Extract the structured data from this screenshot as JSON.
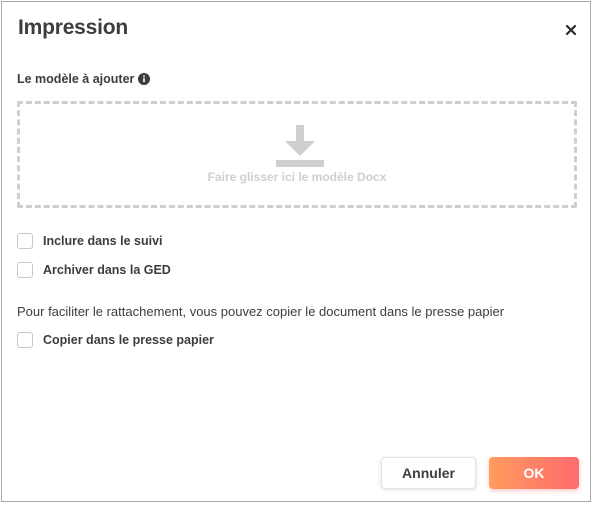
{
  "dialog": {
    "title": "Impression",
    "close_icon": "close-icon"
  },
  "model": {
    "label": "Le modèle à ajouter",
    "info_icon": "info-circle-icon",
    "dropzone_text": "Faire glisser ici le modèle Docx",
    "dropzone_icon": "download-icon"
  },
  "options": {
    "include_label": "Inclure dans le suivi",
    "archive_label": "Archiver dans la GED",
    "clipboard_info": "Pour faciliter le rattachement, vous pouvez copier le document dans le presse papier",
    "clipboard_label": "Copier dans le presse papier"
  },
  "buttons": {
    "cancel_label": "Annuler",
    "ok_label": "OK"
  },
  "colors": {
    "text": "#3d3d3d",
    "dropzone_border": "#cfcfcf",
    "ok_gradient_start": "#ff9c5e",
    "ok_gradient_end": "#ff6a6e"
  }
}
